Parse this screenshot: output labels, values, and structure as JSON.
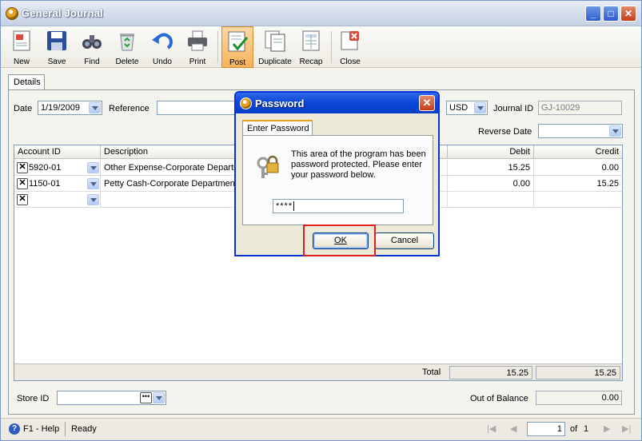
{
  "window": {
    "title": "General Journal",
    "controls": {
      "minimize": "_",
      "maximize": "□",
      "close": "✕"
    }
  },
  "toolbar": {
    "buttons": [
      {
        "label": "New",
        "icon": "new-document-icon"
      },
      {
        "label": "Save",
        "icon": "floppy-disk-icon"
      },
      {
        "label": "Find",
        "icon": "binoculars-icon"
      },
      {
        "label": "Delete",
        "icon": "recycle-bin-icon"
      },
      {
        "label": "Undo",
        "icon": "undo-arrow-icon"
      },
      {
        "label": "Print",
        "icon": "printer-icon"
      },
      {
        "label": "Post",
        "icon": "post-checkmark-icon",
        "active": true
      },
      {
        "label": "Duplicate",
        "icon": "duplicate-icon"
      },
      {
        "label": "Recap",
        "icon": "recap-icon"
      },
      {
        "label": "Close",
        "icon": "close-form-icon"
      }
    ]
  },
  "form": {
    "tab": "Details",
    "date_label": "Date",
    "date_value": "1/19/2009",
    "reference_label": "Reference",
    "reference_value": "",
    "currency_value": "USD",
    "journal_id_label": "Journal ID",
    "journal_id_value": "GJ-10029",
    "reverse_date_label": "Reverse Date",
    "reverse_date_value": ""
  },
  "grid": {
    "columns": [
      "Account ID",
      "Description",
      "Debit",
      "Credit"
    ],
    "rows": [
      {
        "account": "5920-01",
        "description": "Other Expense-Corporate Department",
        "debit": "15.25",
        "credit": "0.00"
      },
      {
        "account": "1150-01",
        "description": "Petty Cash-Corporate Department",
        "debit": "0.00",
        "credit": "15.25"
      },
      {
        "account": "",
        "description": "",
        "debit": "",
        "credit": ""
      }
    ],
    "total_label": "Total",
    "total_debit": "15.25",
    "total_credit": "15.25"
  },
  "footer": {
    "store_id_label": "Store ID",
    "store_id_value": "",
    "out_of_balance_label": "Out of Balance",
    "out_of_balance_value": "0.00"
  },
  "statusbar": {
    "help": "F1 - Help",
    "status": "Ready",
    "page": "1",
    "of_label": "of",
    "total_pages": "1"
  },
  "dialog": {
    "title": "Password",
    "tab": "Enter Password",
    "message": "This area of the program has been password protected.  Please enter your password below.",
    "password_value": "****",
    "ok_label": "OK",
    "cancel_label": "Cancel"
  },
  "colors": {
    "dialog_border": "#0831d9",
    "highlight": "#e02020",
    "active_toolbar": "#f7b25c"
  }
}
